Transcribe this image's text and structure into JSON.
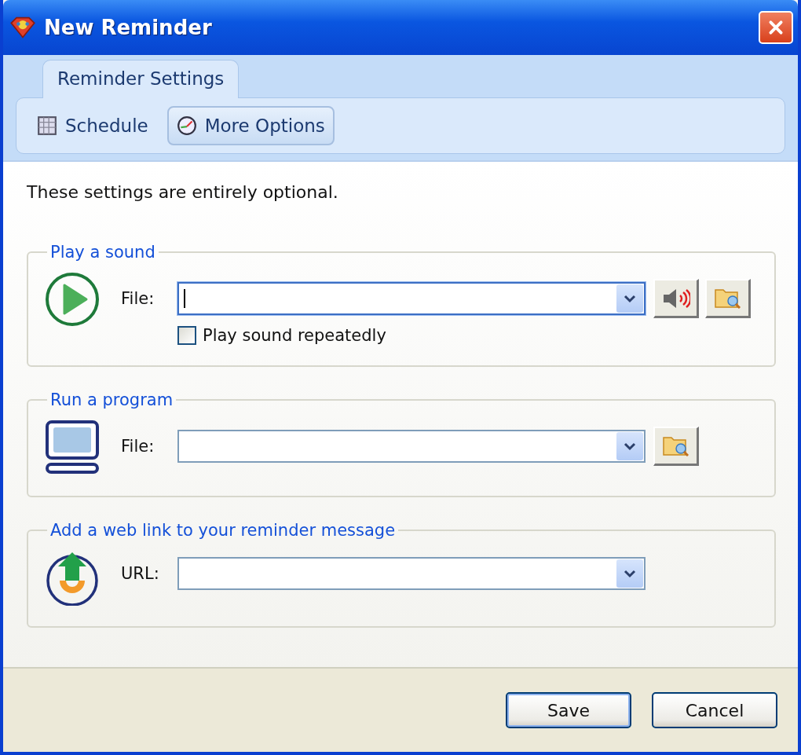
{
  "window": {
    "title": "New Reminder"
  },
  "tabs": [
    {
      "label": "Reminder Settings",
      "selected": true
    }
  ],
  "subtabs": [
    {
      "label": "Schedule",
      "kind": "calendar",
      "selected": false
    },
    {
      "label": "More Options",
      "kind": "gauge",
      "selected": true
    }
  ],
  "intro": "These settings are entirely optional.",
  "groups": [
    {
      "kind": "sound",
      "title": "Play a sound",
      "field_label": "File:",
      "focused": true,
      "buttons": [
        {
          "kind": "speaker"
        },
        {
          "kind": "browse"
        }
      ],
      "checkbox": {
        "label": "Play sound repeatedly",
        "checked": false
      }
    },
    {
      "kind": "program",
      "title": "Run a program",
      "field_label": "File:",
      "focused": false,
      "buttons": [
        {
          "kind": "browse"
        }
      ]
    },
    {
      "kind": "link",
      "title": "Add a web link to your reminder message",
      "field_label": "URL:",
      "focused": false
    }
  ],
  "footer_buttons": [
    {
      "label": "Save",
      "default": true
    },
    {
      "label": "Cancel",
      "default": false
    }
  ]
}
